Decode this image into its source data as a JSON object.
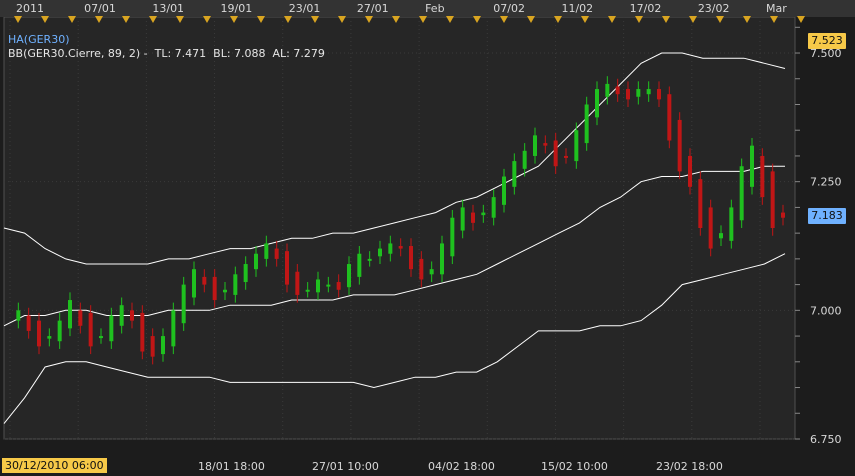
{
  "chart_data": {
    "type": "candlestick",
    "title": "HA(GER30)",
    "indicator_label": "BB(GER30.Cierre, 89, 2) -  TL: 7.471  BL: 7.088  AL: 7.279",
    "top_axis_labels": [
      "2011",
      "07/01",
      "13/01",
      "19/01",
      "23/01",
      "27/01",
      "Feb",
      "07/02",
      "11/02",
      "17/02",
      "23/02",
      "Mar"
    ],
    "bottom_axis_labels": [
      "18/01 18:00",
      "27/01 10:00",
      "04/02 18:00",
      "15/02 10:00",
      "23/02 18:00"
    ],
    "cursor_time_label": "30/12/2010 06:00",
    "y_ticks": [
      "7.500",
      "7.250",
      "7.000",
      "6.750"
    ],
    "ylim": [
      6.75,
      7.57
    ],
    "last_price_label": "7.523",
    "current_price_label": "7.183",
    "bollinger": {
      "period": 89,
      "std": 2,
      "upper": [
        7.16,
        7.15,
        7.12,
        7.1,
        7.09,
        7.09,
        7.09,
        7.09,
        7.1,
        7.1,
        7.11,
        7.12,
        7.12,
        7.13,
        7.14,
        7.14,
        7.15,
        7.15,
        7.16,
        7.17,
        7.18,
        7.19,
        7.21,
        7.22,
        7.24,
        7.26,
        7.28,
        7.32,
        7.36,
        7.4,
        7.44,
        7.48,
        7.5,
        7.5,
        7.49,
        7.49,
        7.49,
        7.48,
        7.47
      ],
      "middle": [
        6.97,
        6.99,
        6.99,
        7.0,
        7.0,
        6.99,
        6.99,
        6.99,
        7.0,
        7.0,
        7.0,
        7.01,
        7.01,
        7.01,
        7.02,
        7.02,
        7.02,
        7.03,
        7.03,
        7.03,
        7.04,
        7.05,
        7.06,
        7.07,
        7.09,
        7.11,
        7.13,
        7.15,
        7.17,
        7.2,
        7.22,
        7.25,
        7.26,
        7.26,
        7.27,
        7.27,
        7.27,
        7.28,
        7.28
      ],
      "lower": [
        6.78,
        6.83,
        6.89,
        6.9,
        6.9,
        6.89,
        6.88,
        6.87,
        6.87,
        6.87,
        6.87,
        6.86,
        6.86,
        6.86,
        6.86,
        6.86,
        6.86,
        6.86,
        6.85,
        6.86,
        6.87,
        6.87,
        6.88,
        6.88,
        6.9,
        6.93,
        6.96,
        6.96,
        6.96,
        6.97,
        6.97,
        6.98,
        7.01,
        7.05,
        7.06,
        7.07,
        7.08,
        7.09,
        7.11
      ]
    },
    "candles": [
      6.98,
      7.0,
      6.96,
      6.93,
      6.95,
      6.98,
      7.02,
      6.97,
      6.93,
      6.95,
      6.99,
      7.01,
      6.98,
      6.92,
      6.91,
      6.95,
      7.0,
      7.05,
      7.08,
      7.05,
      7.02,
      7.04,
      7.07,
      7.09,
      7.11,
      7.13,
      7.1,
      7.05,
      7.03,
      7.04,
      7.06,
      7.05,
      7.04,
      7.09,
      7.11,
      7.1,
      7.12,
      7.13,
      7.12,
      7.08,
      7.06,
      7.08,
      7.13,
      7.18,
      7.2,
      7.17,
      7.19,
      7.22,
      7.26,
      7.29,
      7.31,
      7.34,
      7.32,
      7.28,
      7.3,
      7.35,
      7.4,
      7.43,
      7.44,
      7.42,
      7.41,
      7.43,
      7.43,
      7.41,
      7.33,
      7.27,
      7.24,
      7.16,
      7.12,
      7.15,
      7.2,
      7.28,
      7.32,
      7.22,
      7.16,
      7.18
    ],
    "colors": {
      "up": "#1fc01f",
      "down": "#c01616",
      "band": "#ffffff",
      "last_price_bg": "#f7c948",
      "current_price_bg": "#6fb1ff"
    }
  }
}
